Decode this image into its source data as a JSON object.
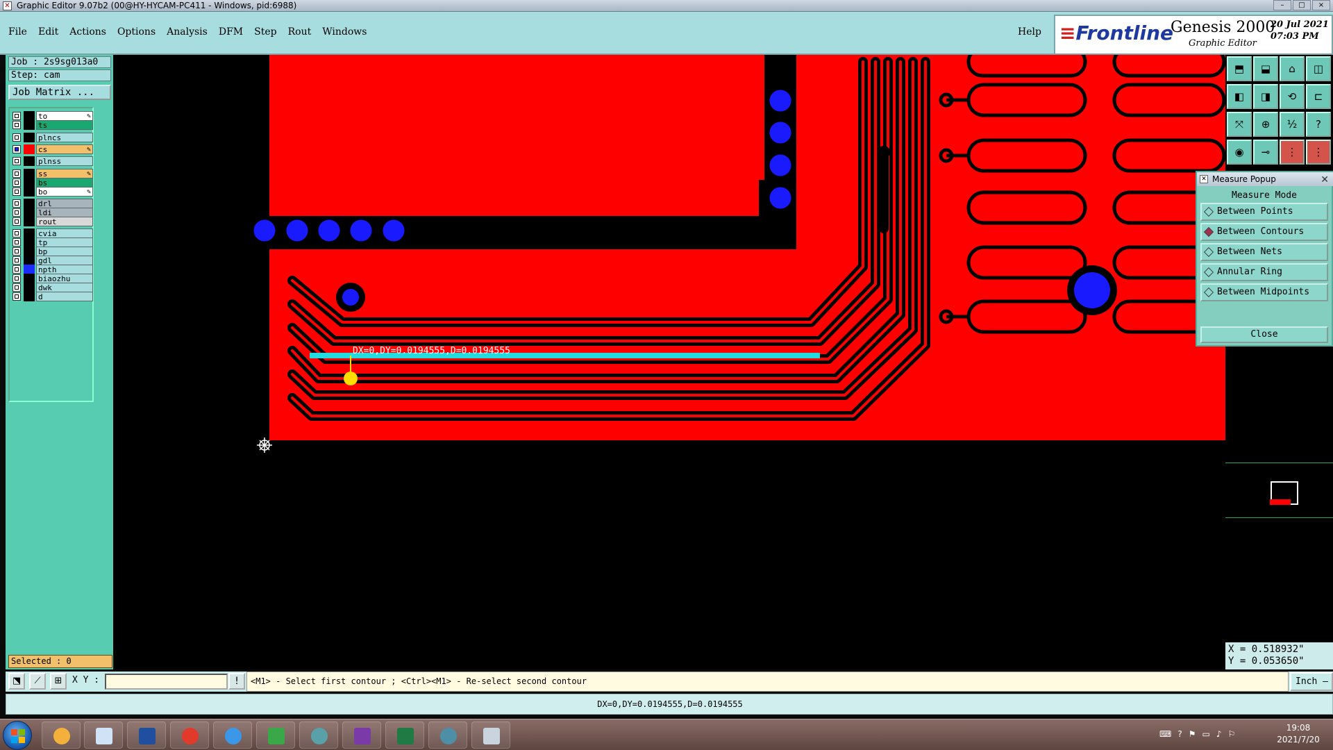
{
  "window": {
    "title": "Graphic Editor 9.07b2 (00@HY-HYCAM-PC411 - Windows, pid:6988)",
    "controls": [
      "–",
      "□",
      "×"
    ]
  },
  "menu": {
    "items": [
      "File",
      "Edit",
      "Actions",
      "Options",
      "Analysis",
      "DFM",
      "Step",
      "Rout",
      "Windows"
    ],
    "help": "Help"
  },
  "logo": {
    "brand": "Frontline",
    "product": "Genesis 2000",
    "subtitle": "Graphic Editor",
    "date": "20 Jul 2021",
    "time": "07:03 PM"
  },
  "left_panel": {
    "job": "Job : 2s9sg013a0",
    "step": "Step: cam",
    "job_matrix": "Job Matrix ...",
    "selected": "Selected : 0",
    "layers": [
      {
        "name": "to",
        "swatch": "#000000",
        "bg": "#ffffff",
        "editable": true
      },
      {
        "name": "ts",
        "swatch": "#000000",
        "bg": "#1aa870",
        "editable": false
      },
      {
        "name": "plncs",
        "swatch": "#000000",
        "bg": "#a8dde0",
        "editable": false
      },
      {
        "name": "cs",
        "swatch": "#ff0000",
        "bg": "#f2c06a",
        "editable": true,
        "active": true
      },
      {
        "name": "plnss",
        "swatch": "#000000",
        "bg": "#a8dde0",
        "editable": false
      },
      {
        "name": "ss",
        "swatch": "#000000",
        "bg": "#f2c06a",
        "editable": true
      },
      {
        "name": "bs",
        "swatch": "#000000",
        "bg": "#1aa870",
        "editable": false
      },
      {
        "name": "bo",
        "swatch": "#000000",
        "bg": "#ffffff",
        "editable": true
      },
      {
        "name": "drl",
        "swatch": "#000000",
        "bg": "#a8b4bc",
        "editable": false
      },
      {
        "name": "ldi",
        "swatch": "#000000",
        "bg": "#a8b4bc",
        "editable": false
      },
      {
        "name": "rout",
        "swatch": "#000000",
        "bg": "#d8d8d8",
        "editable": false
      },
      {
        "name": "cvia",
        "swatch": "#000000",
        "bg": "#a8dde0",
        "editable": false
      },
      {
        "name": "tp",
        "swatch": "#000000",
        "bg": "#a8dde0",
        "editable": false
      },
      {
        "name": "bp",
        "swatch": "#000000",
        "bg": "#a8dde0",
        "editable": false
      },
      {
        "name": "gdl",
        "swatch": "#000000",
        "bg": "#a8dde0",
        "editable": false
      },
      {
        "name": "npth",
        "swatch": "#1a2cff",
        "bg": "#a8dde0",
        "editable": false
      },
      {
        "name": "biaozhu",
        "swatch": "#000000",
        "bg": "#a8dde0",
        "editable": false
      },
      {
        "name": "dwk",
        "swatch": "#000000",
        "bg": "#a8dde0",
        "editable": false
      },
      {
        "name": "d",
        "swatch": "#000000",
        "bg": "#a8dde0",
        "editable": false
      }
    ]
  },
  "canvas": {
    "measure_text": "DX=0,DY=0.0194555,D=0.0194555",
    "colors": {
      "copper": "#ff0000",
      "pad": "#1a1aff",
      "measure_line": "#22dde0",
      "marker": "#ffdd00"
    }
  },
  "measure_popup": {
    "title": "Measure Popup",
    "mode_label": "Measure Mode",
    "options": [
      {
        "label": "Between Points",
        "selected": false
      },
      {
        "label": "Between Contours",
        "selected": true
      },
      {
        "label": "Between Nets",
        "selected": false
      },
      {
        "label": "Annular Ring",
        "selected": false
      },
      {
        "label": "Between Midpoints",
        "selected": false
      }
    ],
    "close": "Close"
  },
  "coords": {
    "x": "X = 0.518932\"",
    "y": "Y = 0.053650\""
  },
  "command": {
    "xy_label": "X Y :",
    "xy_value": "",
    "excl": "!",
    "prompt": "<M1> - Select first contour ; <Ctrl><M1> - Re-select second contour",
    "units": "Inch –"
  },
  "status": {
    "text": "DX=0,DY=0.0194555,D=0.0194555"
  },
  "taskbar": {
    "time": "19:08",
    "date": "2021/7/20"
  }
}
